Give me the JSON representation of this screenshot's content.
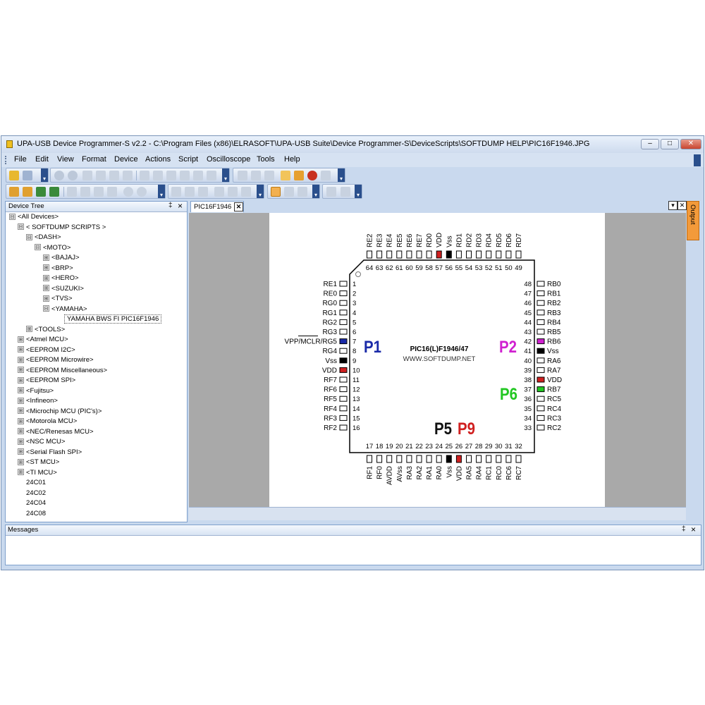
{
  "window": {
    "title": "UPA-USB Device Programmer-S v2.2 - C:\\Program Files (x86)\\ELRASOFT\\UPA-USB Suite\\Device Programmer-S\\DeviceScripts\\SOFTDUMP HELP\\PIC16F1946.JPG",
    "controls": [
      "minimize-icon",
      "restore-icon",
      "close-icon"
    ]
  },
  "menu": [
    "File",
    "Edit",
    "View",
    "Format",
    "Device",
    "Actions",
    "Script",
    "Oscilloscope",
    "Tools",
    "Help"
  ],
  "device_tree": {
    "title": "Device Tree",
    "pin_glyph": "‡",
    "close_glyph": "×",
    "items": [
      {
        "label": "<All Devices>",
        "expander": "⊟"
      },
      {
        "label": "< SOFTDUMP SCRIPTS >",
        "expander": "⊟"
      },
      {
        "label": "<DASH>",
        "expander": "⊟"
      },
      {
        "label": "<MOTO>",
        "expander": "⊟"
      },
      {
        "label": "<BAJAJ>",
        "expander": "⊞"
      },
      {
        "label": "<BRP>",
        "expander": "⊞"
      },
      {
        "label": "<HERO>",
        "expander": "⊞"
      },
      {
        "label": "<SUZUKI>",
        "expander": "⊞"
      },
      {
        "label": "<TVS>",
        "expander": "⊞"
      },
      {
        "label": "<YAMAHA>",
        "expander": "⊟"
      },
      {
        "label": "YAMAHA BWS FI PIC16F1946",
        "expander": ""
      },
      {
        "label": "<TOOLS>",
        "expander": "⊞"
      },
      {
        "label": "<Atmel MCU>",
        "expander": "⊞"
      },
      {
        "label": "<EEPROM I2C>",
        "expander": "⊞"
      },
      {
        "label": "<EEPROM Microwire>",
        "expander": "⊞"
      },
      {
        "label": "<EEPROM Miscellaneous>",
        "expander": "⊞"
      },
      {
        "label": "<EEPROM SPI>",
        "expander": "⊞"
      },
      {
        "label": "<Fujitsu>",
        "expander": "⊞"
      },
      {
        "label": "<Infineon>",
        "expander": "⊞"
      },
      {
        "label": "<Microchip MCU (PIC's)>",
        "expander": "⊞"
      },
      {
        "label": "<Motorola MCU>",
        "expander": "⊞"
      },
      {
        "label": "<NEC/Renesas MCU>",
        "expander": "⊞"
      },
      {
        "label": "<NSC MCU>",
        "expander": "⊞"
      },
      {
        "label": "<Serial Flash SPI>",
        "expander": "⊞"
      },
      {
        "label": "<ST MCU>",
        "expander": "⊞"
      },
      {
        "label": "<TI MCU>",
        "expander": "⊞"
      },
      {
        "label": "24C01",
        "expander": ""
      },
      {
        "label": "24C02",
        "expander": ""
      },
      {
        "label": "24C04",
        "expander": ""
      },
      {
        "label": "24C08",
        "expander": ""
      }
    ]
  },
  "document": {
    "tab_label": "PIC16F1946",
    "tab_close": "✕",
    "dropdown_glyph": "▾",
    "close_glyph": "✕"
  },
  "output_tab": "Output",
  "messages": {
    "title": "Messages",
    "pin_glyph": "‡",
    "close_glyph": "×"
  },
  "diagram": {
    "chip_name": "PIC16(L)F1946/47",
    "website": "WWW.SOFTDUMP.NET",
    "callouts": [
      {
        "text": "P1",
        "color": "#1a2aa8"
      },
      {
        "text": "P2",
        "color": "#d020d0"
      },
      {
        "text": "P6",
        "color": "#22c722"
      },
      {
        "text": "P5",
        "color": "#111111"
      },
      {
        "text": "P9",
        "color": "#d02020"
      }
    ],
    "left_pins": [
      {
        "num": "1",
        "name": "RE1",
        "fill": ""
      },
      {
        "num": "2",
        "name": "RE0",
        "fill": ""
      },
      {
        "num": "3",
        "name": "RG0",
        "fill": ""
      },
      {
        "num": "4",
        "name": "RG1",
        "fill": ""
      },
      {
        "num": "5",
        "name": "RG2",
        "fill": ""
      },
      {
        "num": "6",
        "name": "RG3",
        "fill": ""
      },
      {
        "num": "7",
        "name": "VPP/MCLR/RG5",
        "fill": "#1a2aa8"
      },
      {
        "num": "8",
        "name": "RG4",
        "fill": ""
      },
      {
        "num": "9",
        "name": "Vss",
        "fill": "#000000"
      },
      {
        "num": "10",
        "name": "VDD",
        "fill": "#d02020"
      },
      {
        "num": "11",
        "name": "RF7",
        "fill": ""
      },
      {
        "num": "12",
        "name": "RF6",
        "fill": ""
      },
      {
        "num": "13",
        "name": "RF5",
        "fill": ""
      },
      {
        "num": "14",
        "name": "RF4",
        "fill": ""
      },
      {
        "num": "15",
        "name": "RF3",
        "fill": ""
      },
      {
        "num": "16",
        "name": "RF2",
        "fill": ""
      }
    ],
    "right_pins": [
      {
        "num": "48",
        "name": "RB0",
        "fill": ""
      },
      {
        "num": "47",
        "name": "RB1",
        "fill": ""
      },
      {
        "num": "46",
        "name": "RB2",
        "fill": ""
      },
      {
        "num": "45",
        "name": "RB3",
        "fill": ""
      },
      {
        "num": "44",
        "name": "RB4",
        "fill": ""
      },
      {
        "num": "43",
        "name": "RB5",
        "fill": ""
      },
      {
        "num": "42",
        "name": "RB6",
        "fill": "#d020d0"
      },
      {
        "num": "41",
        "name": "Vss",
        "fill": "#000000"
      },
      {
        "num": "40",
        "name": "RA6",
        "fill": ""
      },
      {
        "num": "39",
        "name": "RA7",
        "fill": ""
      },
      {
        "num": "38",
        "name": "VDD",
        "fill": "#d02020"
      },
      {
        "num": "37",
        "name": "RB7",
        "fill": "#22c722"
      },
      {
        "num": "36",
        "name": "RC5",
        "fill": ""
      },
      {
        "num": "35",
        "name": "RC4",
        "fill": ""
      },
      {
        "num": "34",
        "name": "RC3",
        "fill": ""
      },
      {
        "num": "33",
        "name": "RC2",
        "fill": ""
      }
    ],
    "top_pins": [
      {
        "num": "64",
        "name": "RE2",
        "fill": ""
      },
      {
        "num": "63",
        "name": "RE3",
        "fill": ""
      },
      {
        "num": "62",
        "name": "RE4",
        "fill": ""
      },
      {
        "num": "61",
        "name": "RE5",
        "fill": ""
      },
      {
        "num": "60",
        "name": "RE6",
        "fill": ""
      },
      {
        "num": "59",
        "name": "RE7",
        "fill": ""
      },
      {
        "num": "58",
        "name": "RD0",
        "fill": ""
      },
      {
        "num": "57",
        "name": "VDD",
        "fill": "#d02020"
      },
      {
        "num": "56",
        "name": "Vss",
        "fill": "#000000"
      },
      {
        "num": "55",
        "name": "RD1",
        "fill": ""
      },
      {
        "num": "54",
        "name": "RD2",
        "fill": ""
      },
      {
        "num": "53",
        "name": "RD3",
        "fill": ""
      },
      {
        "num": "52",
        "name": "RD4",
        "fill": ""
      },
      {
        "num": "51",
        "name": "RD5",
        "fill": ""
      },
      {
        "num": "50",
        "name": "RD6",
        "fill": ""
      },
      {
        "num": "49",
        "name": "RD7",
        "fill": ""
      }
    ],
    "bottom_pins": [
      {
        "num": "17",
        "name": "RF1",
        "fill": ""
      },
      {
        "num": "18",
        "name": "RF0",
        "fill": ""
      },
      {
        "num": "19",
        "name": "AVDD",
        "fill": ""
      },
      {
        "num": "20",
        "name": "AVss",
        "fill": ""
      },
      {
        "num": "21",
        "name": "RA3",
        "fill": ""
      },
      {
        "num": "22",
        "name": "RA2",
        "fill": ""
      },
      {
        "num": "23",
        "name": "RA1",
        "fill": ""
      },
      {
        "num": "24",
        "name": "RA0",
        "fill": ""
      },
      {
        "num": "25",
        "name": "Vss",
        "fill": "#000000"
      },
      {
        "num": "26",
        "name": "VDD",
        "fill": "#d02020"
      },
      {
        "num": "27",
        "name": "RA5",
        "fill": ""
      },
      {
        "num": "28",
        "name": "RA4",
        "fill": ""
      },
      {
        "num": "29",
        "name": "RC1",
        "fill": ""
      },
      {
        "num": "30",
        "name": "RC0",
        "fill": ""
      },
      {
        "num": "31",
        "name": "RC6",
        "fill": ""
      },
      {
        "num": "32",
        "name": "RC7",
        "fill": ""
      }
    ]
  }
}
